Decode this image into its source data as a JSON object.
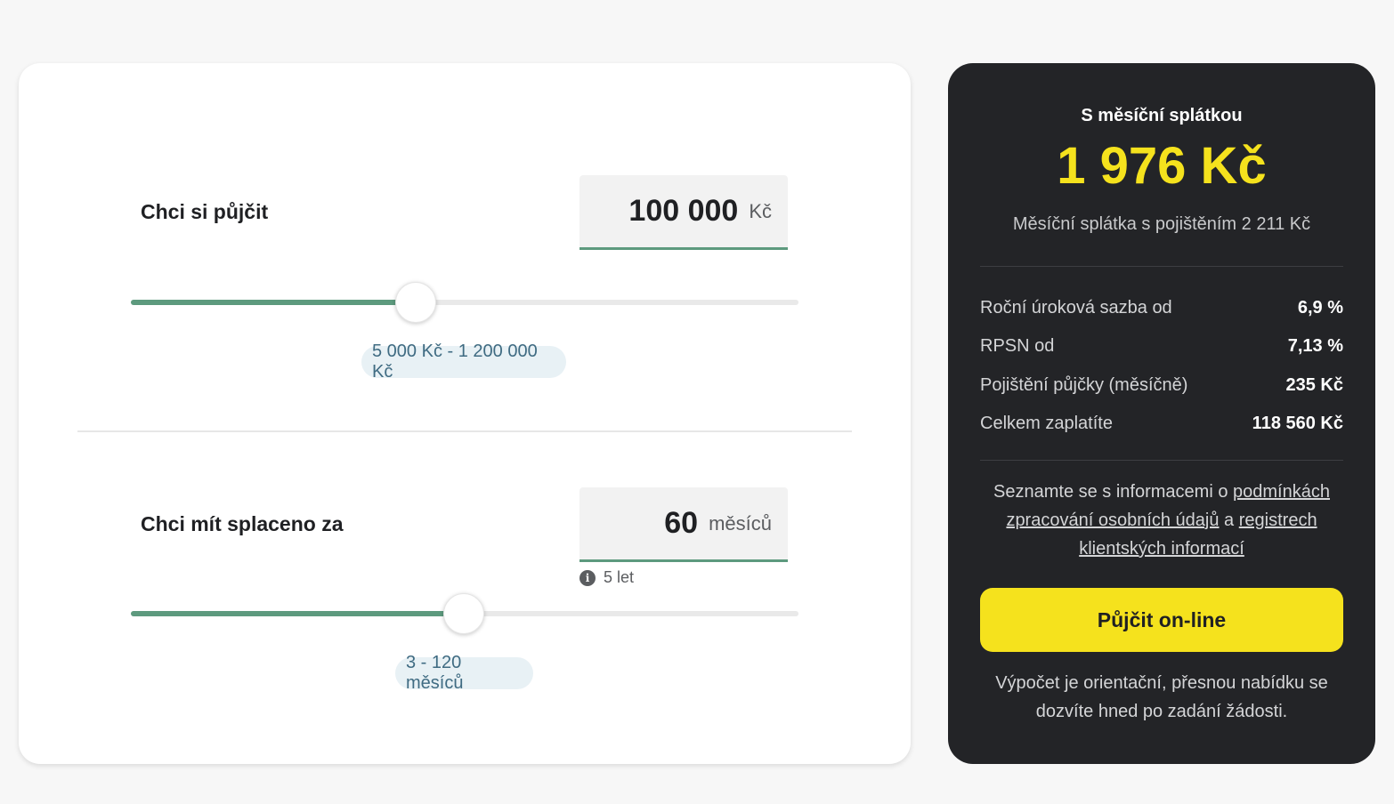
{
  "loan": {
    "label": "Chci si půjčit",
    "value": "100 000",
    "unit": "Kč",
    "range": "5 000 Kč - 1 200 000 Kč",
    "slider_fraction": 0.427
  },
  "term": {
    "label": "Chci mít splaceno za",
    "value": "60",
    "unit": "měsíců",
    "hint": "5 let",
    "range": "3 - 120 měsíců",
    "slider_fraction": 0.499
  },
  "summary": {
    "title": "S měsíční splátkou",
    "amount": "1 976 Kč",
    "with_insurance": "Měsíční splátka s pojištěním 2 211 Kč",
    "rows": [
      {
        "label": "Roční úroková sazba od",
        "value": "6,9 %"
      },
      {
        "label": "RPSN od",
        "value": "7,13 %"
      },
      {
        "label": "Pojištění půjčky (měsíčně)",
        "value": "235 Kč"
      },
      {
        "label": "Celkem zaplatíte",
        "value": "118 560 Kč"
      }
    ],
    "info_prefix": "Seznamte se s informacemi o ",
    "info_link1": "podmínkách zpracování osobních údajů",
    "info_mid": " a ",
    "info_link2": "registrech klientských informací",
    "cta": "Půjčit on-line",
    "note": "Výpočet je orientační, přesnou nabídku se dozvíte hned po zadání žádosti."
  },
  "colors": {
    "accent_green": "#5d9a7e",
    "highlight_yellow": "#f5e21d",
    "dark_panel": "#232427",
    "chip_bg": "#e8f1f5",
    "chip_text": "#3f6b82"
  }
}
